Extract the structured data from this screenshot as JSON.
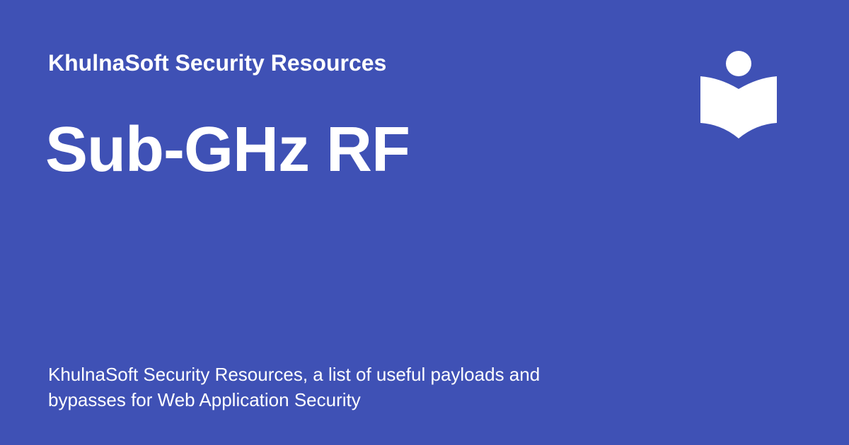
{
  "header": {
    "site_name": "KhulnaSoft Security Resources"
  },
  "main": {
    "title": "Sub-GHz RF"
  },
  "footer": {
    "description": "KhulnaSoft Security Resources, a list of useful payloads and bypasses for Web Application Security"
  },
  "logo": {
    "icon": "reading-person-book-icon"
  },
  "colors": {
    "background": "#3f51b5",
    "text": "#ffffff"
  }
}
